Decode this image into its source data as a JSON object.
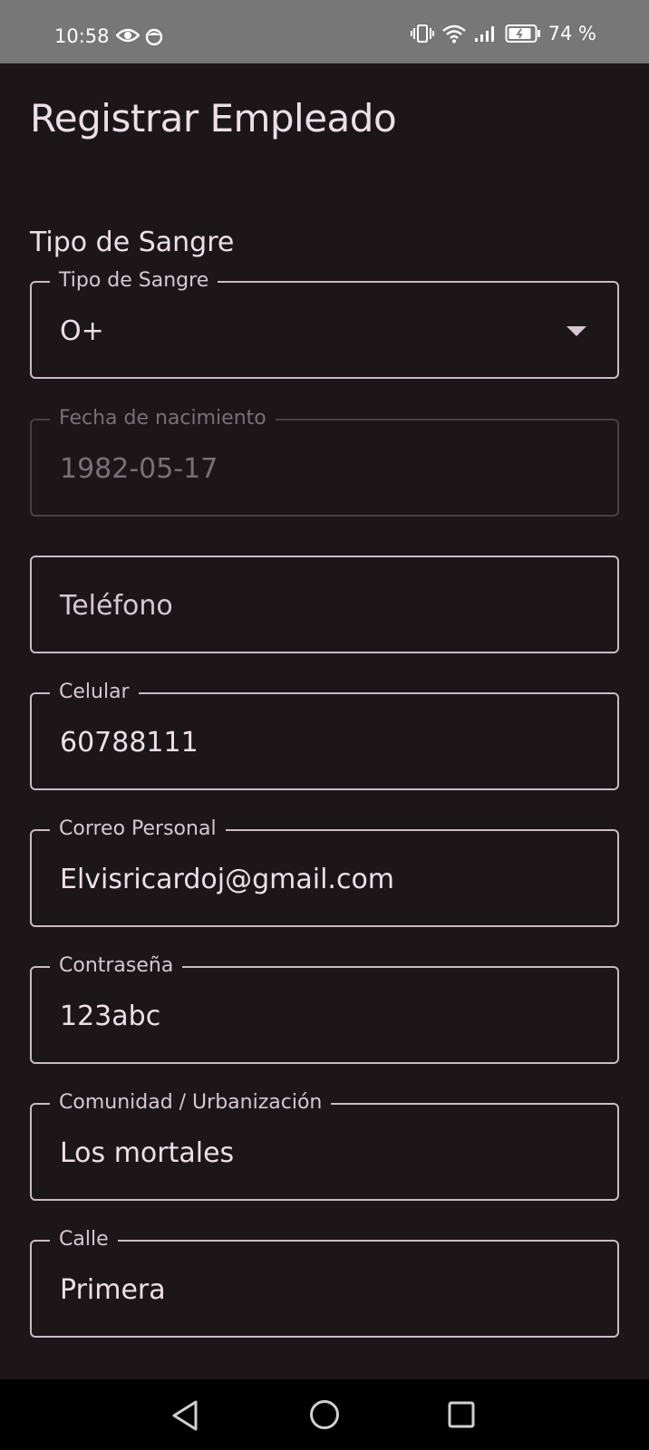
{
  "status_bar": {
    "time": "10:58",
    "battery": "74 %",
    "icons": [
      "eye-icon",
      "face-icon",
      "vibrate-icon",
      "wifi-icon",
      "signal-icon",
      "battery-icon"
    ]
  },
  "page": {
    "title": "Registrar Empleado",
    "section_label": "Tipo de Sangre"
  },
  "form": {
    "blood_type": {
      "label": "Tipo de Sangre",
      "value": "O+"
    },
    "birth_date": {
      "label": "Fecha de nacimiento",
      "value": "1982-05-17",
      "disabled": true
    },
    "phone": {
      "placeholder": "Teléfono",
      "value": ""
    },
    "mobile": {
      "label": "Celular",
      "value": "60788111"
    },
    "email": {
      "label": "Correo Personal",
      "value": "Elvisricardoj@gmail.com"
    },
    "password": {
      "label": "Contraseña",
      "value": "123abc"
    },
    "community": {
      "label": "Comunidad / Urbanización",
      "value": "Los mortales"
    },
    "street": {
      "label": "Calle",
      "value": "Primera"
    }
  },
  "colors": {
    "background": "#1c1619",
    "status_bar": "#777777",
    "text": "#ece0e6",
    "border": "#c9bcc4",
    "disabled": "#7a6f75",
    "nav_bar": "#000000"
  }
}
